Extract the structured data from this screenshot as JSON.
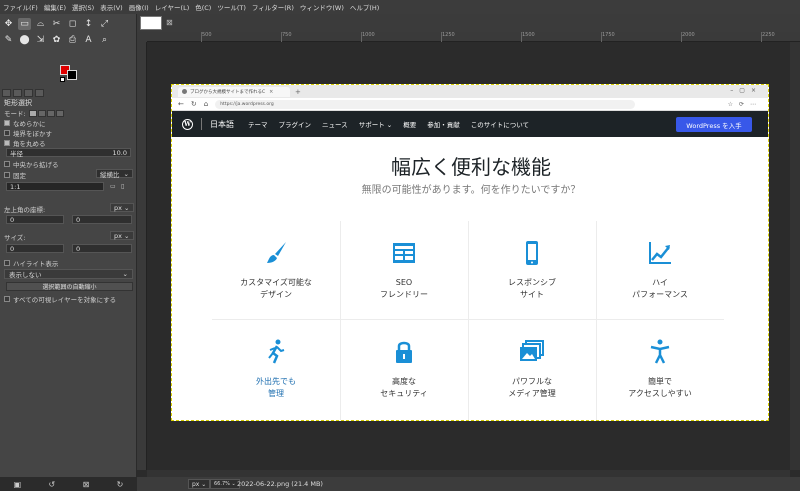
{
  "menu": [
    "ファイル(F)",
    "編集(E)",
    "選択(S)",
    "表示(V)",
    "画像(I)",
    "レイヤー(L)",
    "色(C)",
    "ツール(T)",
    "フィルター(R)",
    "ウィンドウ(W)",
    "ヘルプ(H)"
  ],
  "toolbox": {
    "row1": [
      "✥",
      "▭",
      "⌓",
      "✂",
      "◻",
      "↕",
      "⤢"
    ],
    "row2": [
      "✎",
      "⬤",
      "⇲",
      "✿",
      "⎙",
      "A",
      "⌕"
    ],
    "fg_color": "#e00000",
    "bg_color": "#000000"
  },
  "options": {
    "title": "矩形選択",
    "mode_label": "モード:",
    "antialias": "なめらかに",
    "feather": "境界をぼかす",
    "rounded": "角を丸める",
    "radius_label": "半径",
    "radius_value": "10.0",
    "expand_center": "中央から拡げる",
    "fixed_label": "固定",
    "fixed_mode": "縦横比",
    "ratio_value": "1:1",
    "position_label": "左上角の座標:",
    "position_unit": "px",
    "pos_x": "0",
    "pos_y": "0",
    "size_label": "サイズ:",
    "size_unit": "px",
    "size_w": "0",
    "size_h": "0",
    "highlight": "ハイライト表示",
    "guides": "表示しない",
    "auto_shrink": "選択範囲の自動縮小",
    "all_layers": "すべての可視レイヤーを対象にする"
  },
  "rulers": {
    "ticks": [
      "500",
      "750",
      "1000",
      "1250",
      "1500",
      "1750",
      "2000",
      "2250"
    ]
  },
  "status": {
    "unit": "px",
    "zoom": "66.7%",
    "file": "2022-06-22.png (21.4 MB)"
  },
  "browser": {
    "tab_title": "ブログから大規模サイトまで作れるC",
    "url": "https://ja.wordpress.org"
  },
  "wp": {
    "logo": "W",
    "brand": "日本語",
    "nav": [
      "テーマ",
      "プラグイン",
      "ニュース",
      "サポート ⌄",
      "概要",
      "参加・貢献",
      "このサイトについて"
    ],
    "cta": "WordPress を入手",
    "title": "幅広く便利な機能",
    "subtitle": "無限の可能性があります。何を作りたいですか？",
    "features": [
      {
        "label": "カスタマイズ可能な\nデザイン",
        "icon": "brush-icon",
        "link": false
      },
      {
        "label": "SEO\nフレンドリー",
        "icon": "layout-icon",
        "link": false
      },
      {
        "label": "レスポンシブ\nサイト",
        "icon": "mobile-icon",
        "link": false
      },
      {
        "label": "ハイ\nパフォーマンス",
        "icon": "chart-line-icon",
        "link": false
      },
      {
        "label": "外出先でも\n管理",
        "icon": "running-person-icon",
        "link": true
      },
      {
        "label": "高度な\nセキュリティ",
        "icon": "lock-icon",
        "link": false
      },
      {
        "label": "パワフルな\nメディア管理",
        "icon": "gallery-icon",
        "link": false
      },
      {
        "label": "簡単で\nアクセスしやすい",
        "icon": "accessibility-icon",
        "link": false
      }
    ],
    "accent": "#1a8fd6",
    "cta_color": "#3858e9"
  }
}
